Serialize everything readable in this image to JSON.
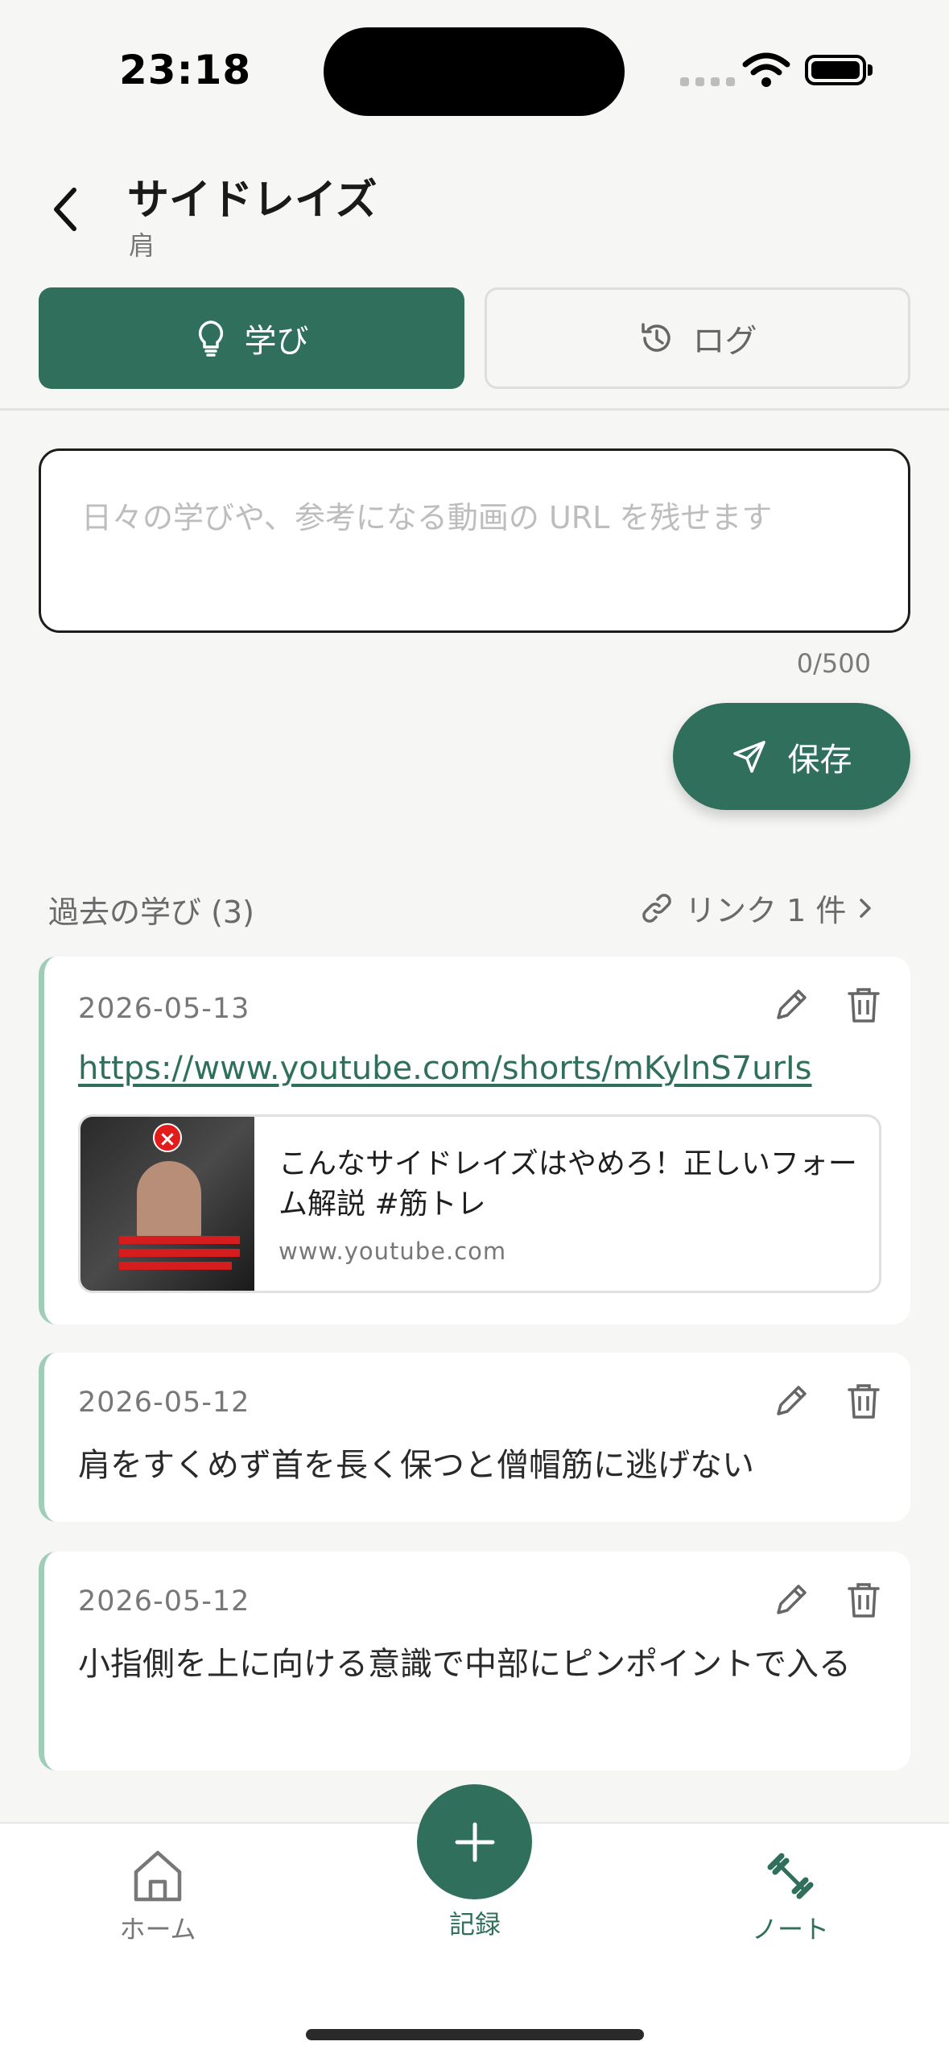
{
  "status_bar": {
    "time": "23:18"
  },
  "header": {
    "title": "サイドレイズ",
    "subtitle": "肩",
    "back_icon": "chevron-left-icon"
  },
  "tabs": [
    {
      "label": "学び",
      "icon": "lightbulb-icon",
      "active": true
    },
    {
      "label": "ログ",
      "icon": "history-icon",
      "active": false
    }
  ],
  "memo": {
    "placeholder": "日々の学びや、参考になる動画の URL を残せます",
    "value": "",
    "counter": "0/500"
  },
  "save_button": {
    "label": "保存",
    "icon": "send-icon"
  },
  "section": {
    "title": "過去の学び (3)",
    "link_summary": "リンク 1 件"
  },
  "entries": [
    {
      "date": "2026-05-13",
      "url": "https://www.youtube.com/shorts/mKylnS7urIs",
      "preview": {
        "title": "こんなサイドレイズはやめろ！正しいフォーム解説 #筋トレ",
        "domain": "www.youtube.com"
      }
    },
    {
      "date": "2026-05-12",
      "text": "肩をすくめず首を長く保つと僧帽筋に逃げない"
    },
    {
      "date": "2026-05-12",
      "text": "小指側を上に向ける意識で中部にピンポイントで入る"
    }
  ],
  "bottom_nav": {
    "home": "ホーム",
    "record": "記録",
    "note": "ノート"
  },
  "colors": {
    "accent": "#2f6f5c",
    "card_border": "#9fcdb8",
    "background": "#f6f6f4"
  }
}
